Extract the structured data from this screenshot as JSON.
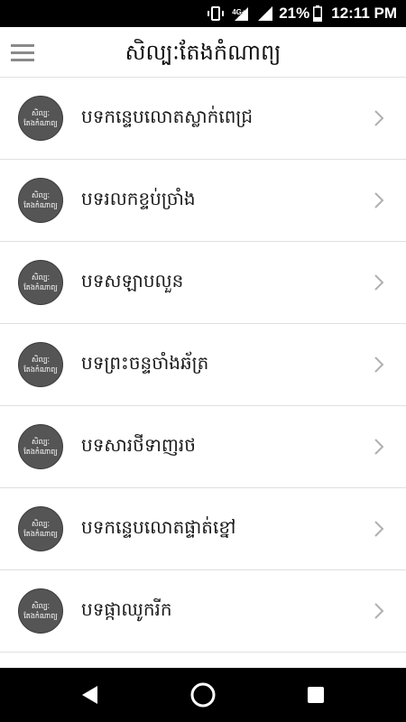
{
  "status_bar": {
    "network": "4G+",
    "battery": "21%",
    "time": "12:11 PM",
    "icons": [
      "vibrate-icon",
      "signal-4g-icon",
      "signal-icon",
      "battery-icon"
    ]
  },
  "app_bar": {
    "title": "សិល្បៈតែងកំណាព្យ",
    "menu_icon": "hamburger-menu-icon"
  },
  "avatar": {
    "line1": "សិល្បៈ",
    "line2": "តែងកំណាព្យ"
  },
  "items": [
    {
      "label": "បទកន្ទេបលោតស្លាក់ពេជ្រ"
    },
    {
      "label": "បទរលកខ្ទប់ច្រាំង"
    },
    {
      "label": "បទសឡាបលួន"
    },
    {
      "label": "បទព្រះចន្ទចាំងឆ័ត្រ"
    },
    {
      "label": "បទសារថីទាញរថ"
    },
    {
      "label": "បទកន្ទេបលោតផ្ទាត់ខ្នៅ"
    },
    {
      "label": "បទផ្កាឈូករីក"
    }
  ],
  "nav_bar": {
    "back_icon": "back-icon",
    "home_icon": "home-icon",
    "recents_icon": "recents-icon"
  },
  "colors": {
    "status_bar": "#000000",
    "avatar_bg": "#555555",
    "divider": "#e0e0e0",
    "chevron": "#b0b0b0"
  }
}
